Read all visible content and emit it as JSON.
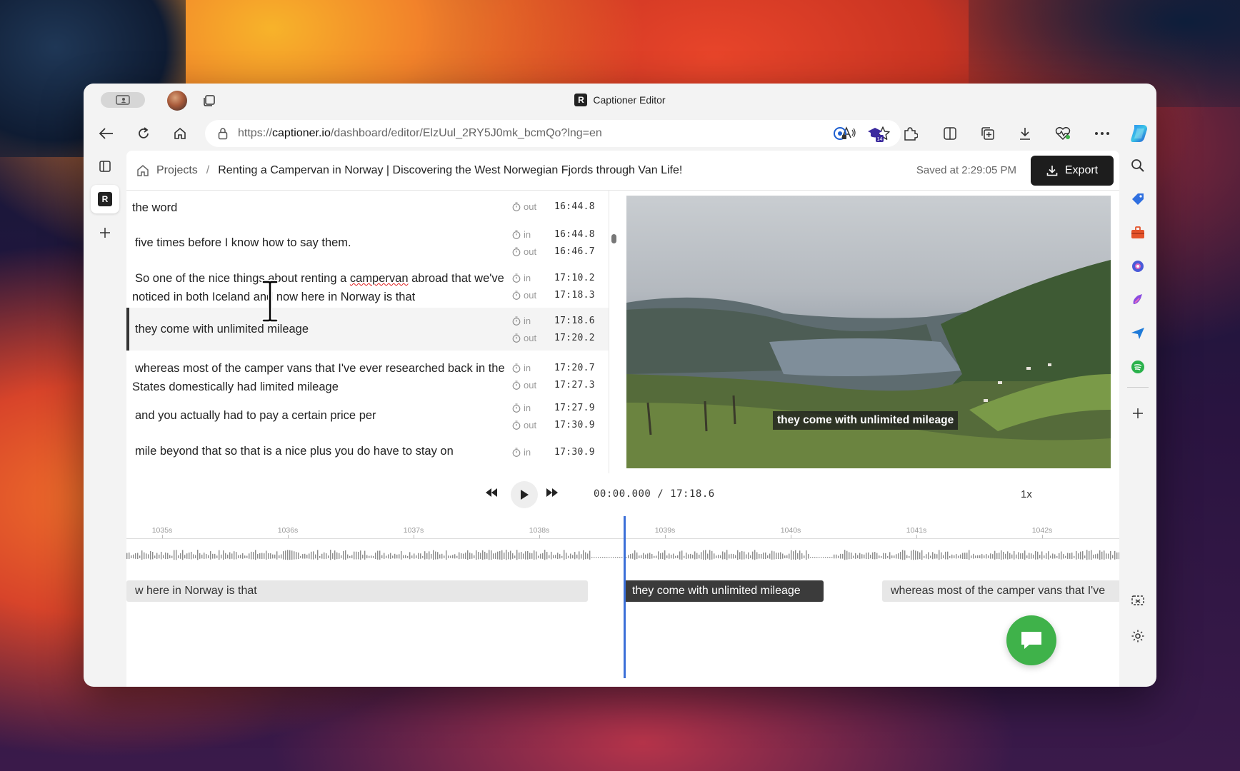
{
  "browser": {
    "tab_title": "Captioner Editor",
    "url_prefix": "https://",
    "url_domain": "captioner.io",
    "url_path": "/dashboard/editor/ElzUul_2RY5J0mk_bcmQo?lng=en",
    "extension_badge": "14"
  },
  "header": {
    "breadcrumb_projects": "Projects",
    "breadcrumb_separator": "/",
    "project_title": "Renting a Campervan in Norway | Discovering the West Norwegian Fjords through Van Life!",
    "saved_status": "Saved at 2:29:05 PM",
    "export_label": "Export"
  },
  "captions": {
    "in_label": "in",
    "out_label": "out",
    "items": [
      {
        "text": "the word",
        "out": "16:44.8"
      },
      {
        "text": "five times before I know how to say them.",
        "in": "16:44.8",
        "out": "16:46.7"
      },
      {
        "text_a": "So one of the nice things about renting a ",
        "text_underlined": "campervan",
        "text_b": " abroad that we've noticed in both Iceland and now here in Norway is that",
        "in": "17:10.2",
        "out": "17:18.3"
      },
      {
        "text": "they come with unlimited mileage",
        "in": "17:18.6",
        "out": "17:20.2",
        "selected": true
      },
      {
        "text": "whereas most of the camper vans that I've ever researched back in the States domestically had limited mileage",
        "in": "17:20.7",
        "out": "17:27.3"
      },
      {
        "text": "and you actually had to pay a certain price per",
        "in": "17:27.9",
        "out": "17:30.9"
      },
      {
        "text": "mile beyond that so that is a nice plus you do have to stay on",
        "in": "17:30.9"
      }
    ]
  },
  "video": {
    "caption_overlay": "they come with unlimited mileage"
  },
  "player": {
    "current_time": "00:00.000",
    "separator": "/",
    "duration": "17:18.6",
    "speed": "1x"
  },
  "timeline": {
    "ticks": [
      "1035s",
      "1036s",
      "1037s",
      "1038s",
      "1039s",
      "1040s",
      "1041s",
      "1042s"
    ],
    "segments": [
      {
        "text": "w here in Norway is that"
      },
      {
        "text": "they come with unlimited mileage",
        "active": true
      },
      {
        "text": "whereas most of the camper vans that I've"
      }
    ]
  },
  "colors": {
    "accent_playhead": "#3b6fd8",
    "export_bg": "#1d1d1d",
    "chat_green": "#3fb24a",
    "spellcheck_red": "#e02020"
  }
}
